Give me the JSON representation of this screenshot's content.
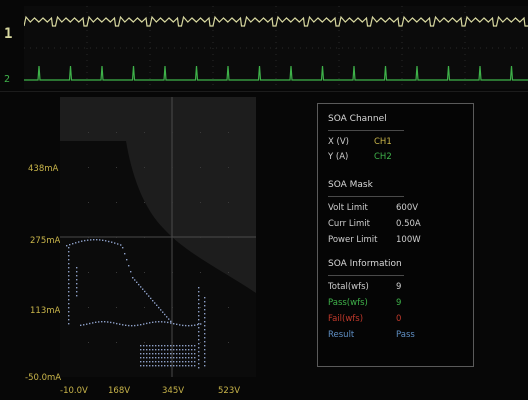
{
  "colors": {
    "ch1": "#d8d8a0",
    "ch2": "#3fb24a",
    "accent_yellow": "#c9b54a",
    "pass_green": "#3fb24a",
    "fail_red": "#c0392b",
    "result_blue": "#5f8fc4",
    "trigger_orange": "#f08a2c"
  },
  "waveform": {
    "ch1_marker": "1",
    "ch2_marker": "2"
  },
  "plot": {
    "y_ticks": [
      "438mA",
      "275mA",
      "113mA",
      "-50.0mA"
    ],
    "x_ticks": [
      "-10.0V",
      "168V",
      "345V",
      "523V"
    ]
  },
  "soa_channel": {
    "title": "SOA Channel",
    "x_label": "X (V)",
    "x_value": "CH1",
    "y_label": "Y (A)",
    "y_value": "CH2"
  },
  "soa_mask": {
    "title": "SOA Mask",
    "volt_label": "Volt Limit",
    "volt_value": "600V",
    "curr_label": "Curr Limit",
    "curr_value": "0.50A",
    "power_label": "Power Limit",
    "power_value": "100W"
  },
  "soa_info": {
    "title": "SOA Information",
    "total_label": "Total(wfs)",
    "total_value": "9",
    "pass_label": "Pass(wfs)",
    "pass_value": "9",
    "fail_label": "Fail(wfs)",
    "fail_value": "0",
    "result_label": "Result",
    "result_value": "Pass"
  }
}
